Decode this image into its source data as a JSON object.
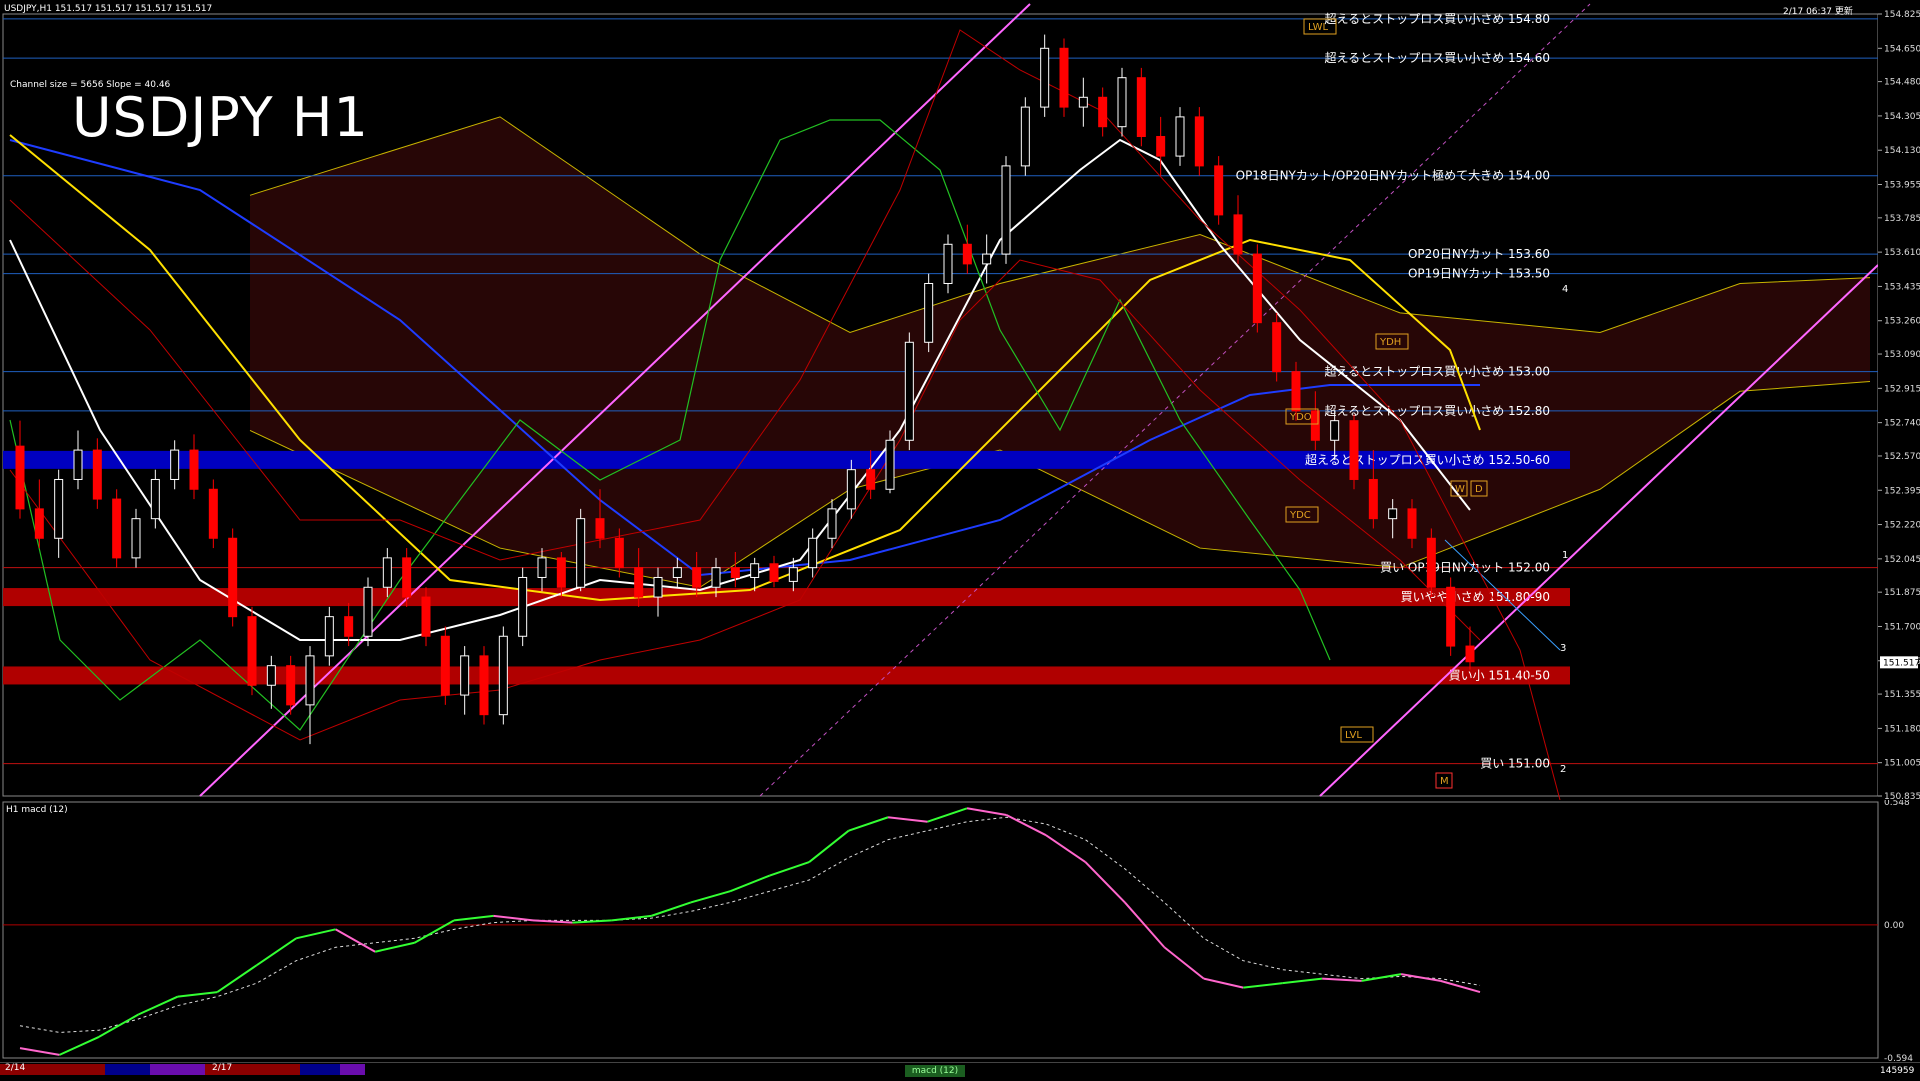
{
  "header": {
    "chart_title": "USDJPY,H1  151.517 151.517 151.517 151.517",
    "time": "2/17 06:37 更新",
    "symbol_big": "USDJPY H1",
    "channel_info": "Channel size = 5656 Slope = 40.46",
    "macd_title": "H1  macd (12)"
  },
  "chart_data": [
    {
      "type": "line",
      "title": "USDJPY H1",
      "price_axis_ticks": [
        "154.825",
        "154.650",
        "154.480",
        "154.305",
        "154.130",
        "153.955",
        "153.785",
        "153.610",
        "153.435",
        "153.260",
        "153.090",
        "152.915",
        "152.740",
        "152.570",
        "152.395",
        "152.220",
        "152.045",
        "151.875",
        "151.700",
        "151.525",
        "151.355",
        "151.180",
        "151.005",
        "150.835"
      ],
      "current_price": "151.517",
      "ylim": [
        150.835,
        154.825
      ],
      "levels": [
        {
          "label": "超えるとストップロス買い小さめ 154.80",
          "price": 154.8
        },
        {
          "label": "超えるとストップロス買い小さめ 154.60",
          "price": 154.6
        },
        {
          "label": "OP18日NYカット/OP20日NYカット極めて大きめ 154.00",
          "price": 154.0
        },
        {
          "label": "OP20日NYカット 153.60",
          "price": 153.6
        },
        {
          "label": "OP19日NYカット 153.50",
          "price": 153.5
        },
        {
          "label": "超えるとストップロス買い小さめ 153.00",
          "price": 153.0
        },
        {
          "label": "超えるとストップロス買い小さめ 152.80",
          "price": 152.8
        },
        {
          "label": "超えるとストップロス買い小さめ 152.50-60",
          "price": 152.55
        },
        {
          "label": "買い OP19日NYカット 152.00",
          "price": 152.0
        },
        {
          "label": "買いやや小さめ 151.80-90",
          "price": 151.85
        },
        {
          "label": "買い小 151.40-50",
          "price": 151.45
        },
        {
          "label": "買い 151.00",
          "price": 151.0
        }
      ],
      "markers": [
        "LWL",
        "YDH",
        "YDO",
        "YDC",
        "LVL",
        "W",
        "D",
        "M",
        "1",
        "2",
        "3",
        "4"
      ],
      "candles": [
        [
          152.62,
          152.75,
          152.25,
          152.3
        ],
        [
          152.3,
          152.45,
          152.1,
          152.15
        ],
        [
          152.15,
          152.5,
          152.05,
          152.45
        ],
        [
          152.45,
          152.7,
          152.4,
          152.6
        ],
        [
          152.6,
          152.66,
          152.3,
          152.35
        ],
        [
          152.35,
          152.4,
          152.0,
          152.05
        ],
        [
          152.05,
          152.3,
          152.0,
          152.25
        ],
        [
          152.25,
          152.5,
          152.2,
          152.45
        ],
        [
          152.45,
          152.65,
          152.4,
          152.6
        ],
        [
          152.6,
          152.68,
          152.35,
          152.4
        ],
        [
          152.4,
          152.45,
          152.1,
          152.15
        ],
        [
          152.15,
          152.2,
          151.7,
          151.75
        ],
        [
          151.75,
          151.8,
          151.35,
          151.4
        ],
        [
          151.4,
          151.55,
          151.28,
          151.5
        ],
        [
          151.5,
          151.55,
          151.25,
          151.3
        ],
        [
          151.3,
          151.6,
          151.1,
          151.55
        ],
        [
          151.55,
          151.8,
          151.5,
          151.75
        ],
        [
          151.75,
          151.82,
          151.6,
          151.65
        ],
        [
          151.65,
          151.95,
          151.6,
          151.9
        ],
        [
          151.9,
          152.1,
          151.85,
          152.05
        ],
        [
          152.05,
          152.1,
          151.8,
          151.85
        ],
        [
          151.85,
          151.9,
          151.6,
          151.65
        ],
        [
          151.65,
          151.7,
          151.3,
          151.35
        ],
        [
          151.35,
          151.6,
          151.25,
          151.55
        ],
        [
          151.55,
          151.6,
          151.2,
          151.25
        ],
        [
          151.25,
          151.7,
          151.2,
          151.65
        ],
        [
          151.65,
          152.0,
          151.6,
          151.95
        ],
        [
          151.95,
          152.1,
          151.88,
          152.05
        ],
        [
          152.05,
          152.08,
          151.85,
          151.9
        ],
        [
          151.9,
          152.3,
          151.88,
          152.25
        ],
        [
          152.25,
          152.4,
          152.1,
          152.15
        ],
        [
          152.15,
          152.2,
          151.95,
          152.0
        ],
        [
          152.0,
          152.1,
          151.8,
          151.85
        ],
        [
          151.85,
          152.0,
          151.75,
          151.95
        ],
        [
          151.95,
          152.05,
          151.9,
          152.0
        ],
        [
          152.0,
          152.08,
          151.85,
          151.9
        ],
        [
          151.9,
          152.05,
          151.85,
          152.0
        ],
        [
          152.0,
          152.08,
          151.9,
          151.95
        ],
        [
          151.95,
          152.05,
          151.88,
          152.02
        ],
        [
          152.02,
          152.06,
          151.9,
          151.93
        ],
        [
          151.93,
          152.05,
          151.88,
          152.0
        ],
        [
          152.0,
          152.2,
          151.95,
          152.15
        ],
        [
          152.15,
          152.35,
          152.1,
          152.3
        ],
        [
          152.3,
          152.55,
          152.25,
          152.5
        ],
        [
          152.5,
          152.6,
          152.35,
          152.4
        ],
        [
          152.4,
          152.7,
          152.38,
          152.65
        ],
        [
          152.65,
          153.2,
          152.6,
          153.15
        ],
        [
          153.15,
          153.5,
          153.1,
          153.45
        ],
        [
          153.45,
          153.7,
          153.4,
          153.65
        ],
        [
          153.65,
          153.75,
          153.5,
          153.55
        ],
        [
          153.55,
          153.7,
          153.45,
          153.6
        ],
        [
          153.6,
          154.1,
          153.55,
          154.05
        ],
        [
          154.05,
          154.4,
          154.0,
          154.35
        ],
        [
          154.35,
          154.72,
          154.3,
          154.65
        ],
        [
          154.65,
          154.7,
          154.3,
          154.35
        ],
        [
          154.35,
          154.5,
          154.25,
          154.4
        ],
        [
          154.4,
          154.45,
          154.2,
          154.25
        ],
        [
          154.25,
          154.55,
          154.2,
          154.5
        ],
        [
          154.5,
          154.55,
          154.15,
          154.2
        ],
        [
          154.2,
          154.3,
          154.0,
          154.1
        ],
        [
          154.1,
          154.35,
          154.05,
          154.3
        ],
        [
          154.3,
          154.35,
          154.0,
          154.05
        ],
        [
          154.05,
          154.1,
          153.75,
          153.8
        ],
        [
          153.8,
          153.9,
          153.55,
          153.6
        ],
        [
          153.6,
          153.65,
          153.2,
          153.25
        ],
        [
          153.25,
          153.3,
          152.95,
          153.0
        ],
        [
          153.0,
          153.05,
          152.75,
          152.8
        ],
        [
          152.8,
          152.9,
          152.6,
          152.65
        ],
        [
          152.65,
          152.8,
          152.55,
          152.75
        ],
        [
          152.75,
          152.78,
          152.4,
          152.45
        ],
        [
          152.45,
          152.6,
          152.2,
          152.25
        ],
        [
          152.25,
          152.35,
          152.15,
          152.3
        ],
        [
          152.3,
          152.35,
          152.1,
          152.15
        ],
        [
          152.15,
          152.2,
          151.85,
          151.9
        ],
        [
          151.9,
          151.95,
          151.55,
          151.6
        ],
        [
          151.6,
          151.7,
          151.48,
          151.52
        ]
      ],
      "overlays": [
        "SMA 21 (white)",
        "SMA 75 (yellow)",
        "SMA 200 (blue)",
        "Bollinger Bands (red)",
        "Ichimoku Cloud",
        "Chikou Span (green)"
      ]
    },
    {
      "type": "line",
      "title": "H1  macd (12)",
      "ylim": [
        -0.594,
        0.548
      ],
      "axis_ticks": [
        "0.548",
        "0.00",
        "-0.594"
      ],
      "series": [
        {
          "values": [
            -0.55,
            -0.58,
            -0.5,
            -0.4,
            -0.32,
            -0.3,
            -0.18,
            -0.06,
            -0.02,
            -0.12,
            -0.08,
            0.02,
            0.04,
            0.02,
            0.01,
            0.02,
            0.04,
            0.1,
            0.15,
            0.22,
            0.28,
            0.42,
            0.48,
            0.46,
            0.52,
            0.49,
            0.4,
            0.28,
            0.1,
            -0.1,
            -0.24,
            -0.28,
            -0.26,
            -0.24,
            -0.25,
            -0.22,
            -0.25,
            -0.3
          ]
        },
        {
          "values": [
            -0.45,
            -0.48,
            -0.47,
            -0.42,
            -0.36,
            -0.32,
            -0.26,
            -0.16,
            -0.1,
            -0.08,
            -0.06,
            -0.02,
            0.01,
            0.02,
            0.02,
            0.02,
            0.03,
            0.06,
            0.1,
            0.15,
            0.2,
            0.3,
            0.38,
            0.42,
            0.46,
            0.48,
            0.45,
            0.38,
            0.25,
            0.1,
            -0.06,
            -0.16,
            -0.2,
            -0.22,
            -0.24,
            -0.23,
            -0.24,
            -0.27
          ]
        }
      ]
    }
  ],
  "footer": {
    "date_1": "2/14",
    "date_2": "2/17",
    "tab": "macd (12)",
    "bottom_right": "145959"
  },
  "colors": {
    "grid_blue": "#1f5fbf",
    "support_band": "#b00000",
    "resistance_band": "#0000c0",
    "up_candle": "#ffffff",
    "down_candle": "#ff0000",
    "macd_up": "#33ff33",
    "macd_down": "#ff66cc"
  }
}
